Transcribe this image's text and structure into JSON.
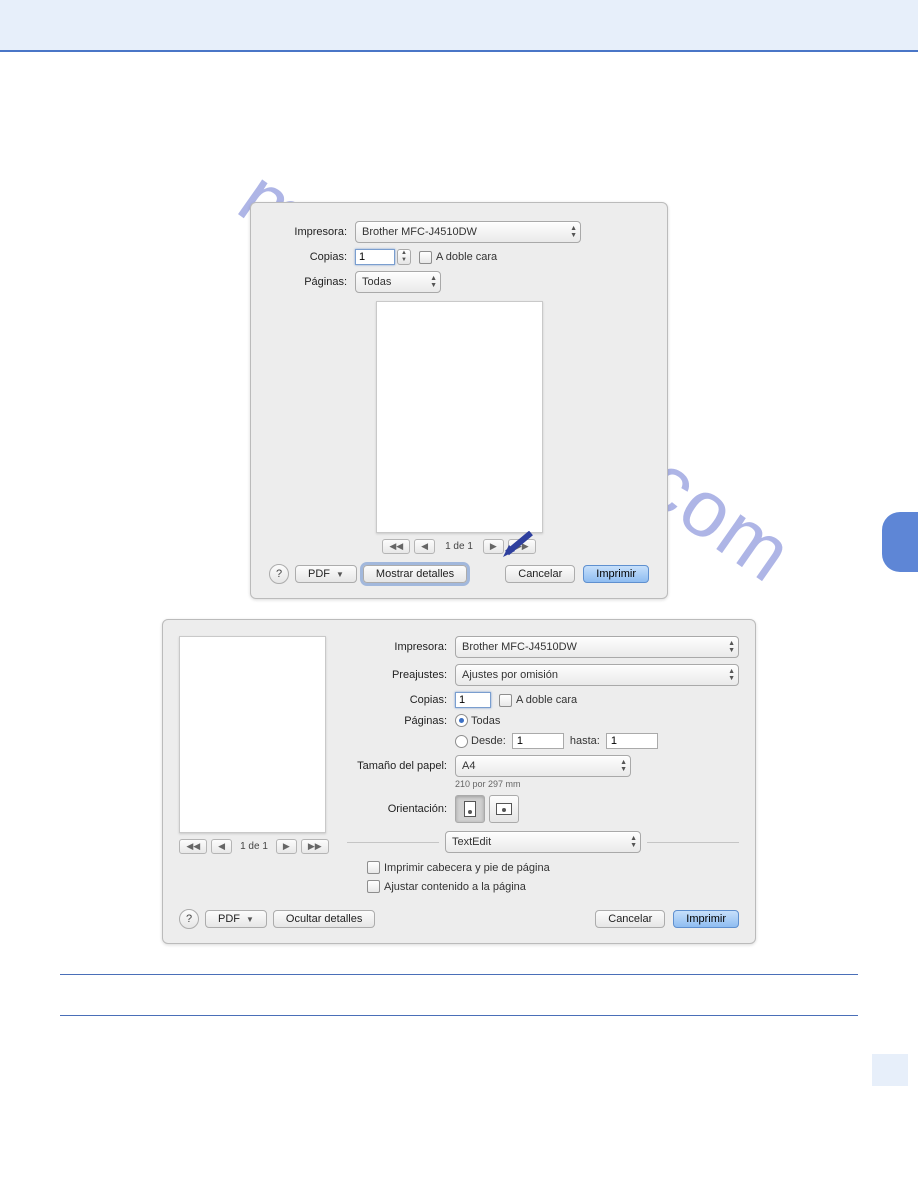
{
  "watermark": "manualshive.com",
  "dialog1": {
    "labels": {
      "impresora": "Impresora:",
      "copias": "Copias:",
      "paginas": "Páginas:"
    },
    "printer": "Brother MFC-J4510DW",
    "copies": "1",
    "doble_cara": "A doble cara",
    "pages_sel": "Todas",
    "page_indicator": "1 de 1",
    "buttons": {
      "pdf": "PDF",
      "mostrar": "Mostrar detalles",
      "cancelar": "Cancelar",
      "imprimir": "Imprimir"
    }
  },
  "dialog2": {
    "labels": {
      "impresora": "Impresora:",
      "preajustes": "Preajustes:",
      "copias": "Copias:",
      "paginas": "Páginas:",
      "tamano": "Tamaño del papel:",
      "orientacion": "Orientación:",
      "desde": "Desde:",
      "hasta": "hasta:"
    },
    "printer": "Brother MFC-J4510DW",
    "preset": "Ajustes por omisión",
    "copies": "1",
    "doble_cara": "A doble cara",
    "todas": "Todas",
    "desde_val": "1",
    "hasta_val": "1",
    "paper": "A4",
    "paper_note": "210 por 297 mm",
    "section_sel": "TextEdit",
    "check1": "Imprimir cabecera y pie de página",
    "check2": "Ajustar contenido a la página",
    "page_indicator": "1 de 1",
    "buttons": {
      "pdf": "PDF",
      "ocultar": "Ocultar detalles",
      "cancelar": "Cancelar",
      "imprimir": "Imprimir"
    }
  }
}
